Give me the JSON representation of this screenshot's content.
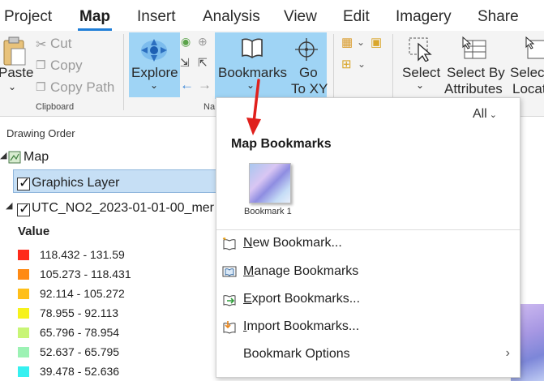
{
  "tabs": [
    {
      "label": "Project",
      "active": false
    },
    {
      "label": "Map",
      "active": true
    },
    {
      "label": "Insert",
      "active": false
    },
    {
      "label": "Analysis",
      "active": false
    },
    {
      "label": "View",
      "active": false
    },
    {
      "label": "Edit",
      "active": false
    },
    {
      "label": "Imagery",
      "active": false
    },
    {
      "label": "Share",
      "active": false
    }
  ],
  "ribbon": {
    "paste_label": "Paste",
    "cut_label": "Cut",
    "copy_label": "Copy",
    "copy_path_label": "Copy Path",
    "clipboard_group": "Clipboard",
    "explore_label": "Explore",
    "nav_group": "Na",
    "bookmarks_label": "Bookmarks",
    "goto_line1": "Go",
    "goto_line2": "To XY",
    "select_label": "Select",
    "select_by_attr_line1": "Select By",
    "select_by_attr_line2": "Attributes",
    "select_loc_line1": "Selec",
    "select_loc_line2": "Locat"
  },
  "contents": {
    "title": "Drawing Order",
    "map_label": "Map",
    "graphics_layer": "Graphics Layer",
    "layer_name": "UTC_NO2_2023-01-01-00_mer",
    "value_heading": "Value",
    "legend": [
      {
        "range": "118.432 - 131.59",
        "color": "#ff2a1a"
      },
      {
        "range": "105.273 - 118.431",
        "color": "#ff8a14"
      },
      {
        "range": "92.114 - 105.272",
        "color": "#ffbf1a"
      },
      {
        "range": "78.955 - 92.113",
        "color": "#f6f21c"
      },
      {
        "range": "65.796 - 78.954",
        "color": "#c8f576"
      },
      {
        "range": "52.637 - 65.795",
        "color": "#9cf2b4"
      },
      {
        "range": "39.478 - 52.636",
        "color": "#36f0f0"
      }
    ]
  },
  "dropdown": {
    "filter_label": "All",
    "header": "Map Bookmarks",
    "bookmark_label": "Bookmark 1",
    "items": [
      {
        "underline": "N",
        "rest": "ew Bookmark...",
        "icon": "new-bookmark-icon"
      },
      {
        "underline": "M",
        "rest": "anage Bookmarks",
        "icon": "manage-bookmarks-icon"
      },
      {
        "underline": "E",
        "rest": "xport Bookmarks...",
        "icon": "export-bookmarks-icon"
      },
      {
        "underline": "I",
        "rest": "mport Bookmarks...",
        "icon": "import-bookmarks-icon"
      }
    ],
    "options_label": "Bookmark Options"
  },
  "colors": {
    "accent": "#1f7ed8",
    "highlight": "#9fd4f5",
    "annotation_arrow": "#e0201c"
  }
}
